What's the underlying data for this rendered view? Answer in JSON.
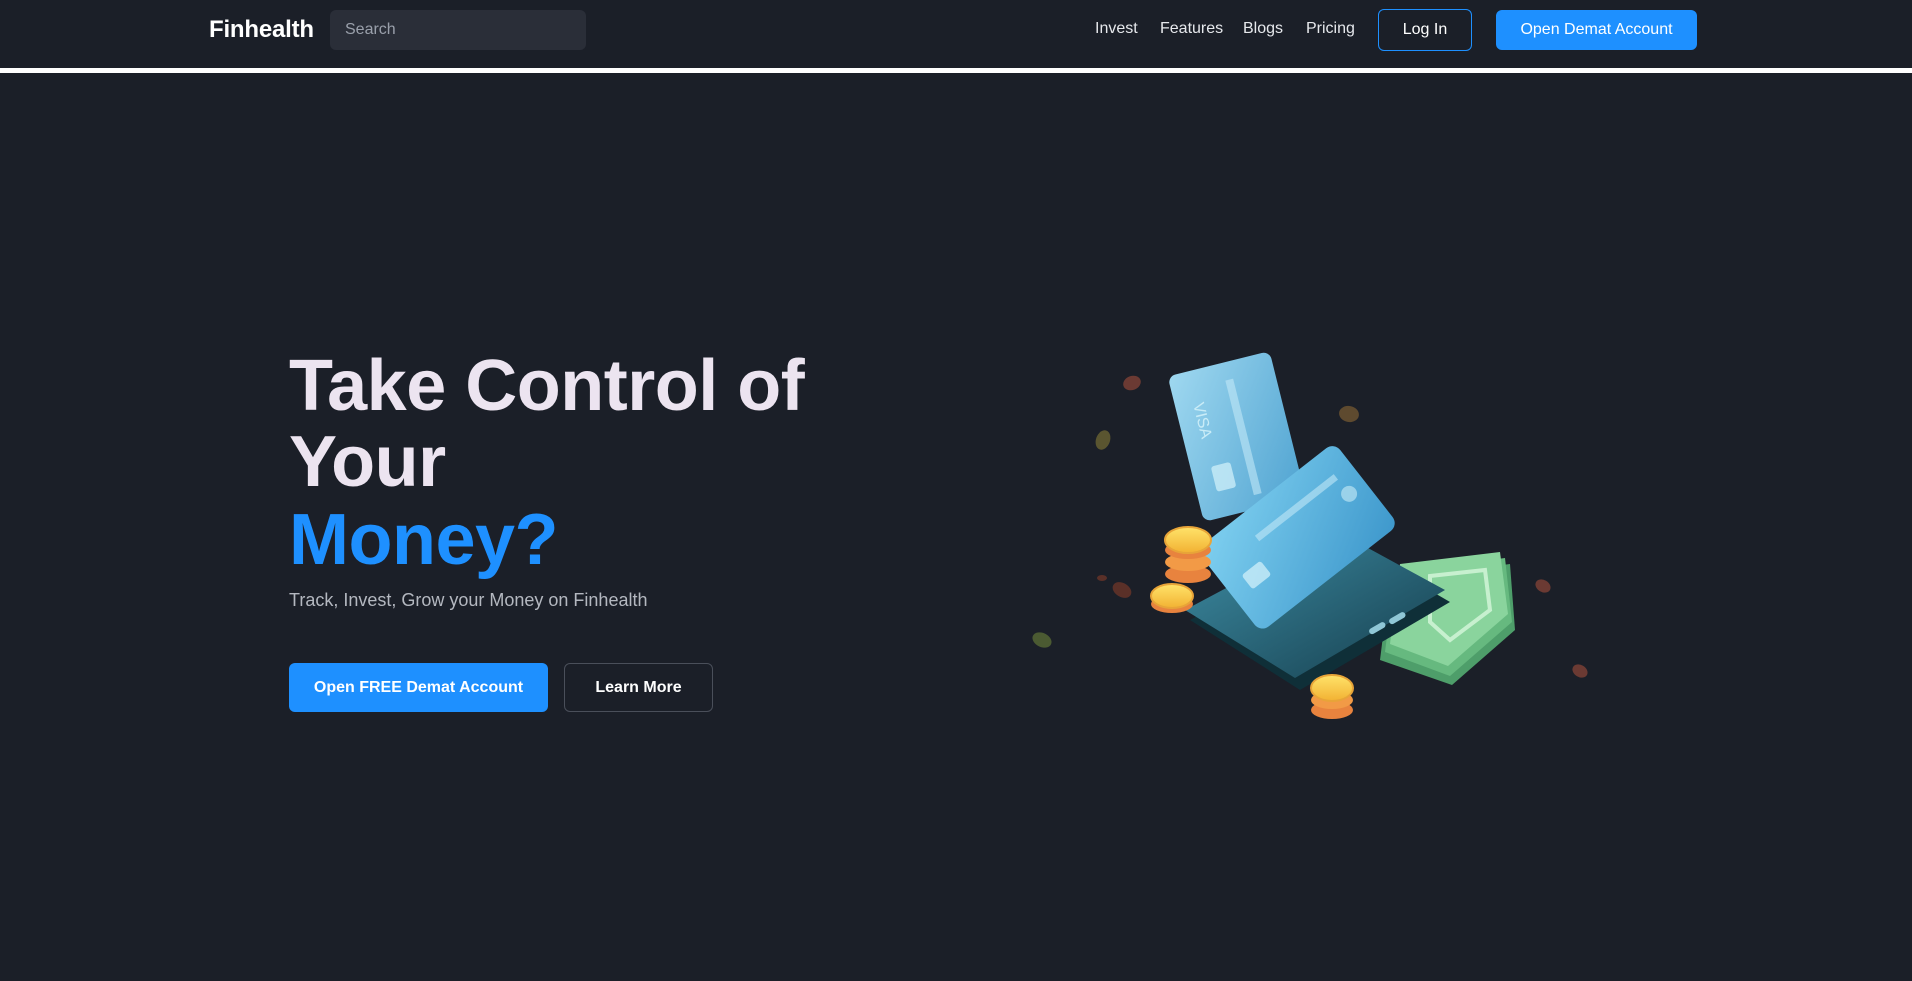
{
  "header": {
    "brand": "Finhealth",
    "search": {
      "placeholder": "Search",
      "value": ""
    },
    "nav": [
      "Invest",
      "Features",
      "Blogs",
      "Pricing"
    ],
    "login_label": "Log In",
    "open_account_label": "Open Demat Account"
  },
  "hero": {
    "title_line1": "Take Control of",
    "title_line2": "Your",
    "title_accent": "Money?",
    "subtitle": "Track, Invest, Grow your Money on Finhealth",
    "primary_cta": "Open FREE Demat Account",
    "secondary_cta": "Learn More"
  },
  "colors": {
    "background": "#1b1f28",
    "accent": "#1e90ff",
    "heading": "#ece4f0"
  },
  "illustration": {
    "icons": [
      "credit-card-icon",
      "phone-icon",
      "coin-stack-icon",
      "cash-bills-icon",
      "leaf-icon"
    ]
  }
}
